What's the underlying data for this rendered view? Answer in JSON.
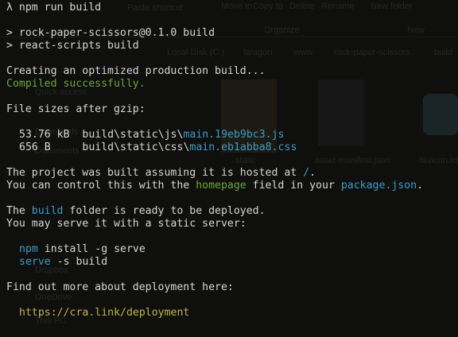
{
  "window": {
    "app": "cmder terminal",
    "theme": {
      "background": "#0f0f0e",
      "text": "#d6d6d6",
      "green": "#6aaa3a",
      "cyan": "#3c9dc8",
      "yellow": "#bdb64a"
    }
  },
  "background_explorer": {
    "ribbon": [
      "Paste shortcut",
      "Move to",
      "Copy to",
      "Delete",
      "Rename",
      "New folder"
    ],
    "ribbon_groups": [
      "Organize",
      "New"
    ],
    "breadcrumb": [
      "Local Disk (C:)",
      "laragon",
      "www",
      "rock-paper-scissors",
      "build"
    ],
    "nav_items": [
      "Quick access",
      "Downloads",
      "Documents",
      "Dropbox",
      "OneDrive",
      "This PC"
    ],
    "files": [
      "static",
      "asset-manifest.json",
      "favicon.ico"
    ]
  },
  "terminal": {
    "prompt_symbol": "λ",
    "command": "npm run build",
    "script_line_1": "> rock-paper-scissors@0.1.0 build",
    "script_line_2": "> react-scripts build",
    "creating": "Creating an optimized production build...",
    "compiled": "Compiled successfully.",
    "sizes_header": "File sizes after gzip:",
    "files": [
      {
        "size": "53.76 kB",
        "dir": "build\\static\\js\\",
        "name": "main.19eb9bc3.js"
      },
      {
        "size": "656 B   ",
        "dir": "build\\static\\css\\",
        "name": "main.eb1abba8.css"
      }
    ],
    "hosted_pre": "The project was built assuming it is hosted at ",
    "hosted_path": "/",
    "hosted_post": ".",
    "control_pre": "You can control this with the ",
    "control_homepage": "homepage",
    "control_mid": " field in your ",
    "control_pkg": "package.json",
    "control_post": ".",
    "ready_pre": "The ",
    "ready_build": "build",
    "ready_post": " folder is ready to be deployed.",
    "serve_line": "You may serve it with a static server:",
    "npm_cmd": "npm",
    "npm_rest": " install -g serve",
    "serve_cmd": "serve",
    "serve_rest": " -s build",
    "findout": "Find out more about deployment here:",
    "link": "https://cra.link/deployment"
  }
}
